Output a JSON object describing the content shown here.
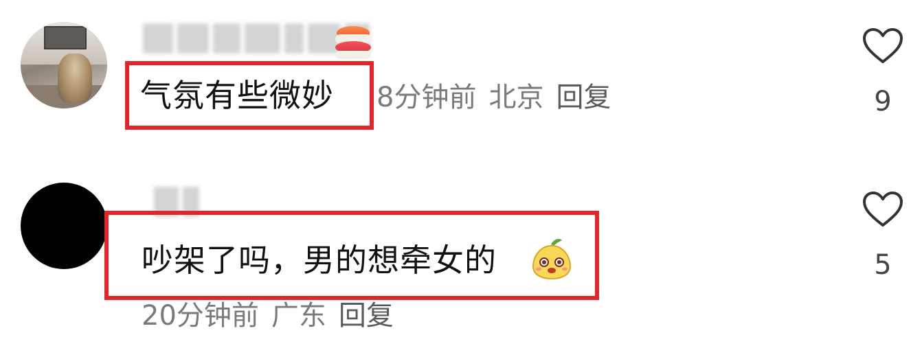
{
  "comments": [
    {
      "text": "气氛有些微妙",
      "time": "8分钟前",
      "location": "北京",
      "reply_label": "回复",
      "like_count": "9",
      "badge_icon": "sushi-icon"
    },
    {
      "text": "吵架了吗，男的想牵女的",
      "time": "20分钟前",
      "location": "广东",
      "reply_label": "回复",
      "like_count": "5",
      "emoji_icon": "cute-bun-emoji-icon"
    }
  ],
  "colors": {
    "highlight_box": "#e1252b",
    "meta_text": "#7a7a7a",
    "comment_text": "#111111"
  }
}
